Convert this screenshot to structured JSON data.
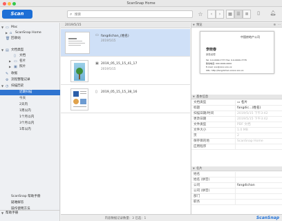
{
  "window": {
    "title": "ScanSnap Home"
  },
  "toolbar": {
    "scan_label": "Scan",
    "search_placeholder": "搜索"
  },
  "sidebar": {
    "items": [
      {
        "label": "Mac"
      },
      {
        "label": "ScanSnap Home"
      },
      {
        "label": "回收站"
      },
      {
        "label": "文档类型"
      },
      {
        "label": "文档"
      },
      {
        "label": "名片"
      },
      {
        "label": "照片"
      },
      {
        "label": "收据"
      },
      {
        "label": "流程整理记录"
      },
      {
        "label": "扫描历史"
      },
      {
        "label": "近期扫描"
      },
      {
        "label": "今天"
      },
      {
        "label": "2天内"
      },
      {
        "label": "1周以内"
      },
      {
        "label": "1个月以内"
      },
      {
        "label": "3个月以内"
      },
      {
        "label": "1年以内"
      }
    ],
    "help": [
      {
        "label": "帮助手册"
      },
      {
        "label": "ScanSnap 帮助手册"
      },
      {
        "label": "疑难解答"
      },
      {
        "label": "操作使用方法"
      }
    ]
  },
  "list": {
    "header": "2019/5/15",
    "docs": [
      {
        "name": "fangdichan_(姓名)",
        "sub": "2019/5/15"
      },
      {
        "name": "2019_05_15_15_41_17",
        "sub": "2019/5/15"
      },
      {
        "name": "2019_05_15_15_38_16",
        "sub": ""
      }
    ]
  },
  "status": {
    "text": "内容数据记录数量：3  已选：1",
    "brand": "ScanSnap"
  },
  "preview": {
    "section": "预览",
    "card_company": "中国房地产公司",
    "card_name": "李晓春",
    "card_title": "销售经理",
    "card_tel": "Tel: 0-0-0000-7777  Fax: 0-0-0000-7778",
    "card_mobile": "移动电话: 000-0000-0000",
    "card_email": "E-mail: xxx@xxxx.xxx.xx",
    "card_url": "URL: http://fangdichan.xxxxx.xxx.xx"
  },
  "basic_info": {
    "section": "基本信息",
    "rows": [
      {
        "key": "文档类型",
        "value": "名片"
      },
      {
        "key": "标题",
        "value": "fangdic…(姓名)"
      },
      {
        "key": "扫描日期/时间",
        "value": "2019/5/15 下午3:42"
      },
      {
        "key": "更改日期",
        "value": "2019/5/15 下午3:42"
      },
      {
        "key": "文件类型",
        "value": "PDF 文档"
      },
      {
        "key": "文件大小",
        "value": "1.0 MB"
      },
      {
        "key": "页",
        "value": "2"
      },
      {
        "key": "保存目的地",
        "value": "ScanSnap Home"
      },
      {
        "key": "应用程序",
        "value": ""
      }
    ]
  },
  "card_info": {
    "section": "名片",
    "rows": [
      {
        "key": "姓名",
        "value": ""
      },
      {
        "key": "姓名 (拼音)",
        "value": ""
      },
      {
        "key": "公司",
        "value": "fangdichan"
      },
      {
        "key": "公司 (拼音)",
        "value": ""
      },
      {
        "key": "部门",
        "value": ""
      },
      {
        "key": "职务",
        "value": ""
      }
    ]
  }
}
